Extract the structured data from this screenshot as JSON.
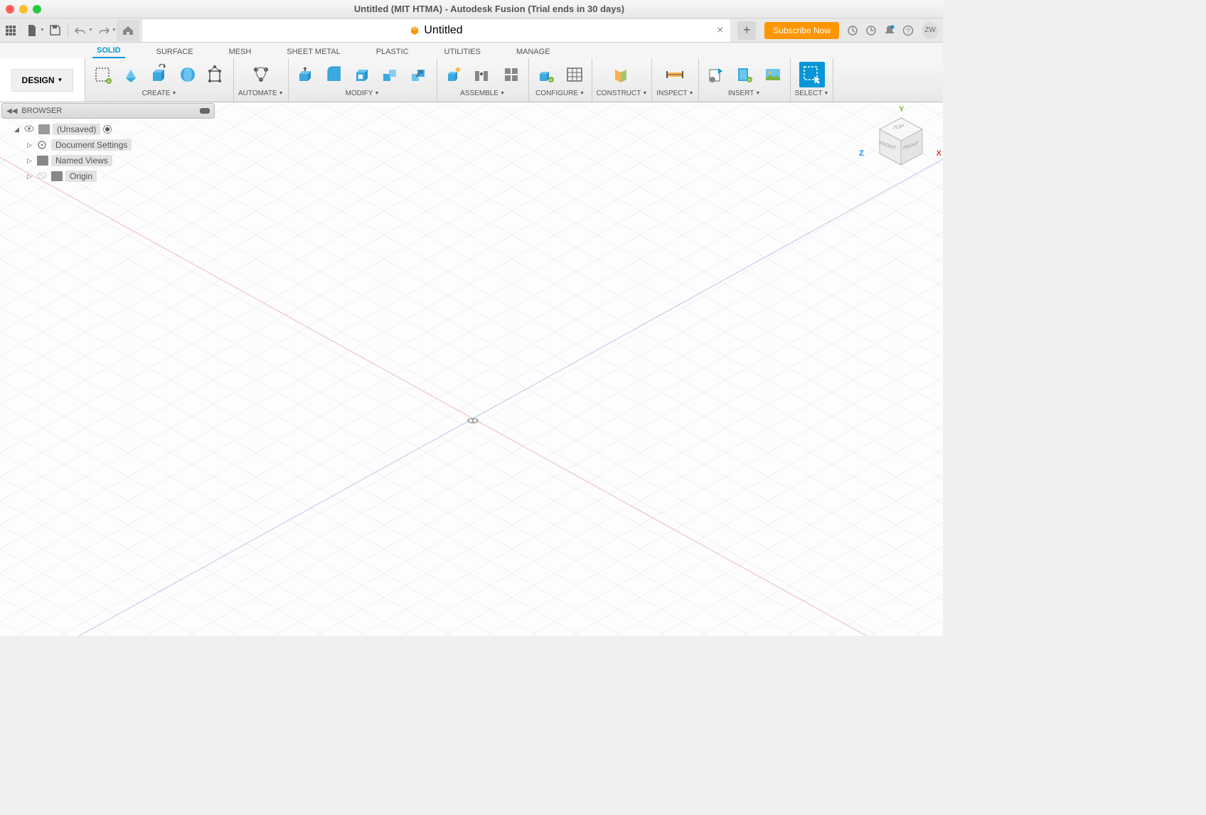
{
  "titlebar": {
    "title": "Untitled (MIT HTMA) - Autodesk Fusion (Trial ends in 30 days)"
  },
  "qat": {
    "doctab_label": "Untitled",
    "subscribe_label": "Subscribe Now",
    "avatar_initials": "ZW"
  },
  "workspace": {
    "label": "DESIGN"
  },
  "ribbon_tabs": [
    "SOLID",
    "SURFACE",
    "MESH",
    "SHEET METAL",
    "PLASTIC",
    "UTILITIES",
    "MANAGE"
  ],
  "ribbon_groups": {
    "create": "CREATE",
    "automate": "AUTOMATE",
    "modify": "MODIFY",
    "assemble": "ASSEMBLE",
    "configure": "CONFIGURE",
    "construct": "CONSTRUCT",
    "inspect": "INSPECT",
    "insert": "INSERT",
    "select": "SELECT"
  },
  "browser": {
    "title": "BROWSER",
    "root": "(Unsaved)",
    "items": [
      {
        "label": "Document Settings"
      },
      {
        "label": "Named Views"
      },
      {
        "label": "Origin"
      }
    ]
  },
  "viewcube": {
    "top": "TOP",
    "front": "FRONT",
    "right": "RIGHT",
    "axes": {
      "x": "X",
      "y": "Y",
      "z": "Z"
    }
  }
}
